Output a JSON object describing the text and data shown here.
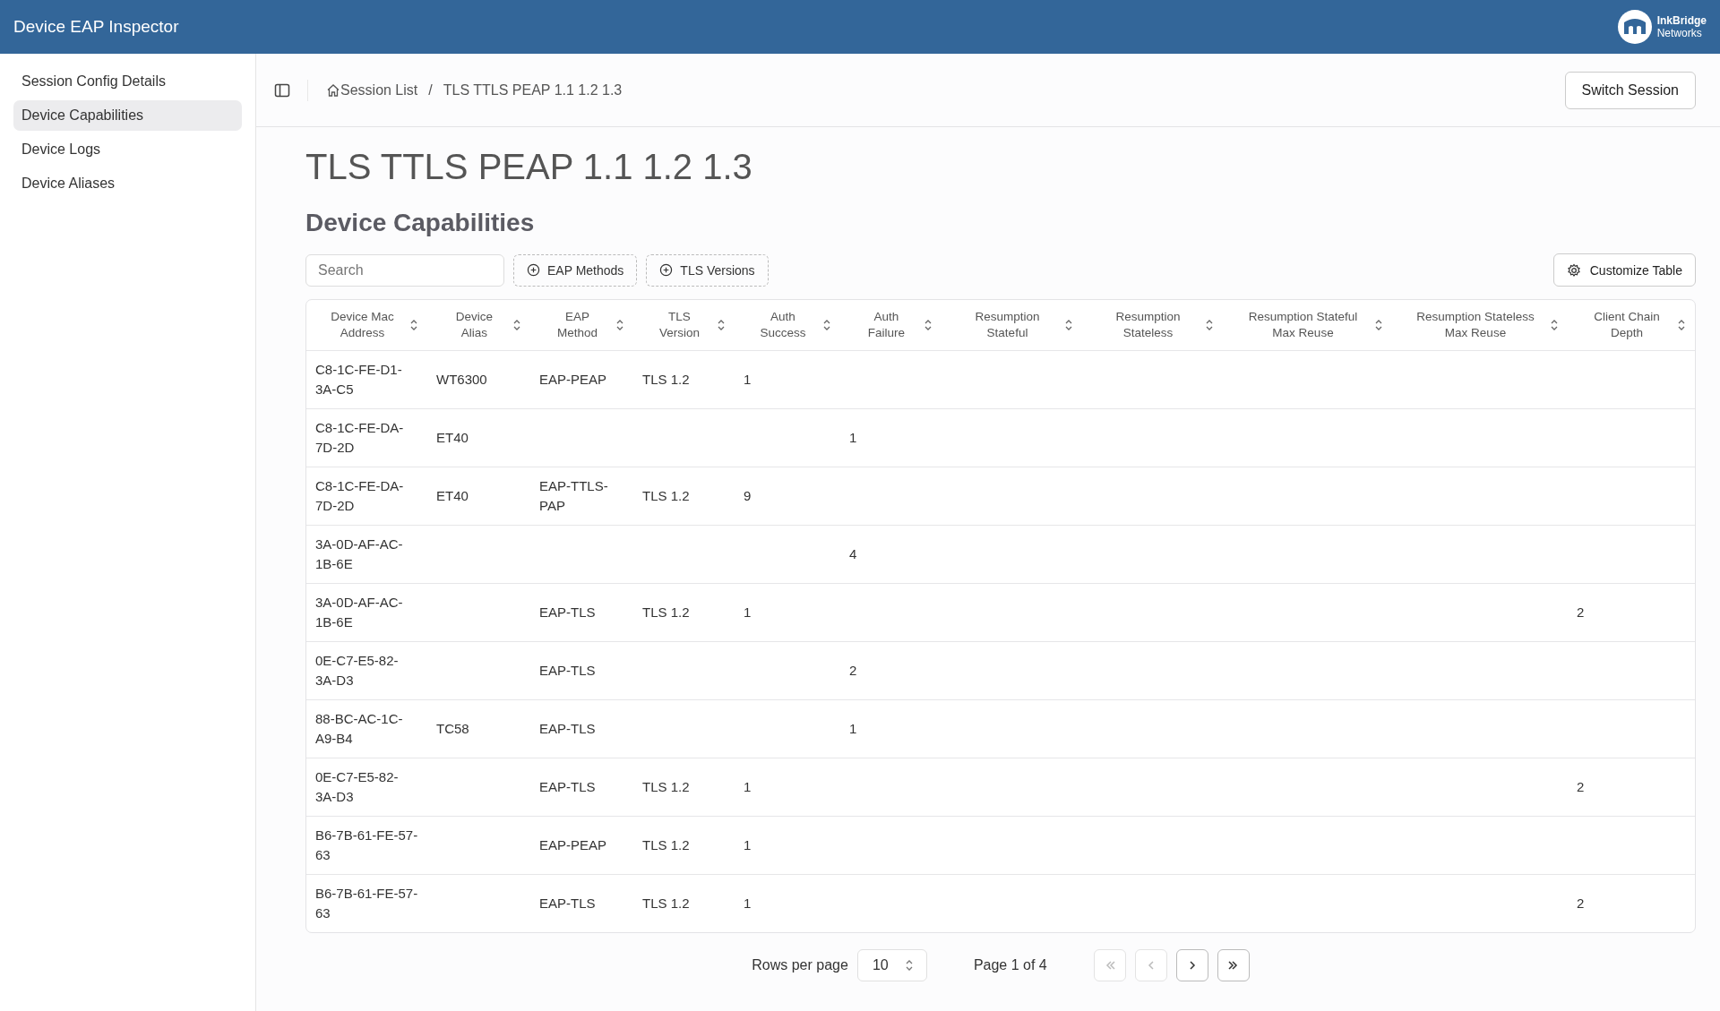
{
  "app_bar": {
    "title": "Device EAP Inspector",
    "logo_line_1": "InkBridge",
    "logo_line_2": "Networks"
  },
  "sidebar": {
    "items": [
      {
        "label": "Session Config Details",
        "selected": false
      },
      {
        "label": "Device Capabilities",
        "selected": true
      },
      {
        "label": "Device Logs",
        "selected": false
      },
      {
        "label": "Device Aliases",
        "selected": false
      }
    ]
  },
  "breadcrumb": {
    "items": [
      "Session List",
      "TLS TTLS PEAP 1.1 1.2 1.3"
    ],
    "separator": "/"
  },
  "switch_button": "Switch Session",
  "page_title": "TLS TTLS PEAP 1.1 1.2 1.3",
  "section_title": "Device Capabilities",
  "search": {
    "placeholder": "Search"
  },
  "filters": [
    "EAP Methods",
    "TLS Versions"
  ],
  "customize_button": "Customize Table",
  "table": {
    "columns": [
      "Device Mac Address",
      "Device Alias",
      "EAP Method",
      "TLS Version",
      "Auth Success",
      "Auth Failure",
      "Resumption Stateful",
      "Resumption Stateless",
      "Resumption Stateful Max Reuse",
      "Resumption Stateless Max Reuse",
      "Client Chain Depth"
    ],
    "rows": [
      [
        "C8-1C-FE-D1-3A-C5",
        "WT6300",
        "EAP-PEAP",
        "TLS 1.2",
        "1",
        null,
        null,
        null,
        null,
        null,
        null
      ],
      [
        "C8-1C-FE-DA-7D-2D",
        "ET40",
        null,
        null,
        null,
        "1",
        null,
        null,
        null,
        null,
        null
      ],
      [
        "C8-1C-FE-DA-7D-2D",
        "ET40",
        "EAP-TTLS-PAP",
        "TLS 1.2",
        "9",
        null,
        null,
        null,
        null,
        null,
        null
      ],
      [
        "3A-0D-AF-AC-1B-6E",
        null,
        null,
        null,
        null,
        "4",
        null,
        null,
        null,
        null,
        null
      ],
      [
        "3A-0D-AF-AC-1B-6E",
        null,
        "EAP-TLS",
        "TLS 1.2",
        "1",
        null,
        null,
        null,
        null,
        null,
        "2"
      ],
      [
        "0E-C7-E5-82-3A-D3",
        null,
        "EAP-TLS",
        null,
        null,
        "2",
        null,
        null,
        null,
        null,
        null
      ],
      [
        "88-BC-AC-1C-A9-B4",
        "TC58",
        "EAP-TLS",
        null,
        null,
        "1",
        null,
        null,
        null,
        null,
        null
      ],
      [
        "0E-C7-E5-82-3A-D3",
        null,
        "EAP-TLS",
        "TLS 1.2",
        "1",
        null,
        null,
        null,
        null,
        null,
        "2"
      ],
      [
        "B6-7B-61-FE-57-63",
        null,
        "EAP-PEAP",
        "TLS 1.2",
        "1",
        null,
        null,
        null,
        null,
        null,
        null
      ],
      [
        "B6-7B-61-FE-57-63",
        null,
        "EAP-TLS",
        "TLS 1.2",
        "1",
        null,
        null,
        null,
        null,
        null,
        "2"
      ]
    ]
  },
  "pagination": {
    "rows_per_page_label": "Rows per page",
    "rows_per_page": "10",
    "page_info": "Page 1 of 4",
    "buttons": [
      {
        "kind": "first",
        "disabled": true
      },
      {
        "kind": "prev",
        "disabled": true
      },
      {
        "kind": "next",
        "disabled": false
      },
      {
        "kind": "last",
        "disabled": false
      }
    ]
  }
}
